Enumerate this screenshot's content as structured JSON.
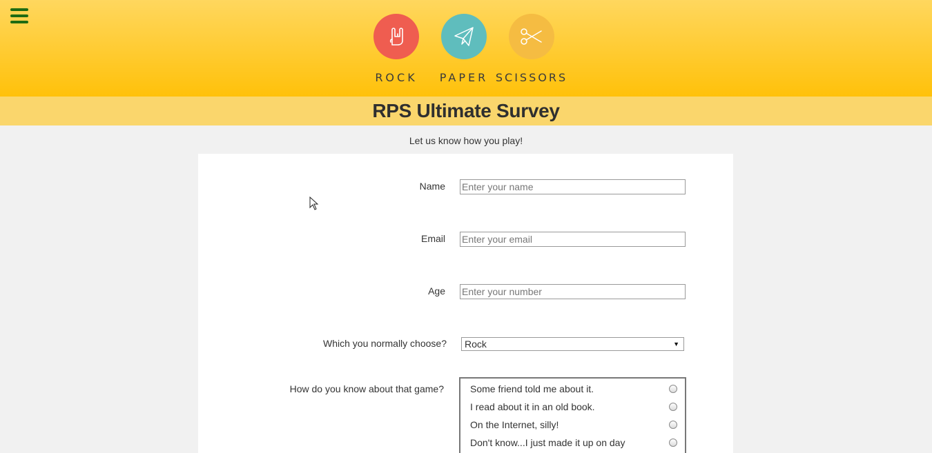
{
  "header": {
    "logos": [
      {
        "label": "ROCK",
        "icon": "rock-hand-icon",
        "color": "#ef5d50"
      },
      {
        "label": "PAPER",
        "icon": "paper-plane-icon",
        "color": "#5fbdbd"
      },
      {
        "label": "SCISSORS",
        "icon": "scissors-icon",
        "color": "#f5bc42"
      }
    ]
  },
  "title": "RPS Ultimate Survey",
  "subtitle": "Let us know how you play!",
  "form": {
    "name": {
      "label": "Name",
      "placeholder": "Enter your name",
      "value": ""
    },
    "email": {
      "label": "Email",
      "placeholder": "Enter your email",
      "value": ""
    },
    "age": {
      "label": "Age",
      "placeholder": "Enter your number",
      "value": ""
    },
    "choice": {
      "label": "Which you normally choose?",
      "selected": "Rock"
    },
    "source": {
      "label": "How do you know about that game?",
      "options": [
        "Some friend told me about it.",
        "I read about it in an old book.",
        "On the Internet, silly!",
        "Don't know...I just made it up on day"
      ]
    }
  },
  "colors": {
    "header_top": "#ffd75e",
    "header_bottom": "#ffc10a",
    "title_bar": "#fad66c",
    "menu_icon": "#1f6b12"
  }
}
